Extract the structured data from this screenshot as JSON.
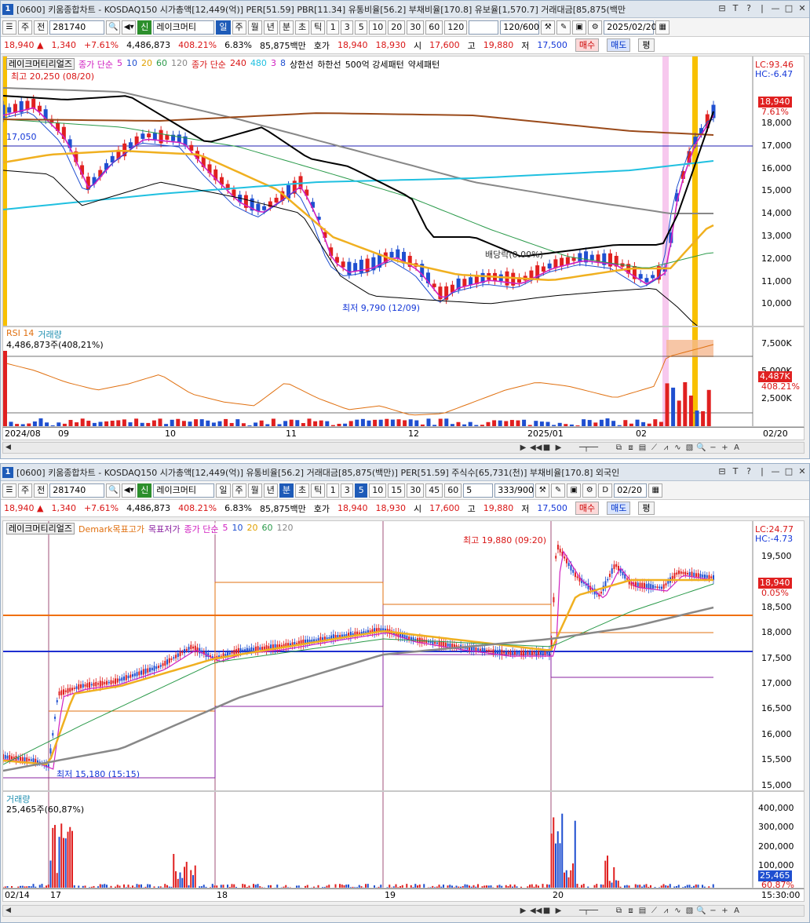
{
  "top": {
    "title": {
      "num": "1",
      "text": "[0600] 키움종합차트 - KOSDAQ150 시가총액[12,449(억)] PER[51.59] PBR[11.34] 유통비율[56.2] 부채비율[170.8] 유보율[1,570.7] 거래대금[85,875(백만"
    },
    "title_buttons": [
      "⊟",
      "T",
      "?",
      "|",
      "—",
      "□",
      "✕"
    ],
    "toolbar": {
      "mode": "주",
      "prev": "전",
      "code": "281740",
      "name": "레이크머티",
      "periods": [
        "일",
        "주",
        "월",
        "년",
        "분",
        "초",
        "틱"
      ],
      "active_period": "일",
      "nums": [
        "1",
        "3",
        "5",
        "10",
        "20",
        "30",
        "60",
        "120"
      ],
      "count": "120/600",
      "date": "2025/02/20"
    },
    "quote": {
      "price": "18,940 ▲",
      "change": "1,340",
      "rate": "+7.61%",
      "volume": "4,486,873",
      "vol_rate": "408.21%",
      "turnover": "6.83%",
      "amount": "85,875백만",
      "bid_label": "호가",
      "ask": "18,940",
      "bid": "18,930",
      "open_label": "시",
      "open": "17,600",
      "high_label": "고",
      "high": "19,880",
      "low_label": "저",
      "low": "17,500",
      "buy": "매수",
      "sell": "매도",
      "avg": "평"
    },
    "legend1": {
      "name": "레이크머티리얼즈",
      "ma_label": "종가 단순",
      "ma": [
        "5",
        "10",
        "20",
        "60",
        "120"
      ]
    },
    "legend1b": {
      "high": "최고 20,250 (08/20)",
      "ma_label": "종가 단순",
      "ma": [
        "240",
        "480",
        "3",
        "8"
      ],
      "upper": "상한선",
      "lower": "하한선",
      "strong": "500억 강세패턴",
      "weak": "약세패턴"
    },
    "annotations": {
      "low": "최저 9,790 (12/09)",
      "dividend": "배당락(0.00%)",
      "left_price": "17,050"
    },
    "right_axis": {
      "lc": "LC:93.46",
      "hc": "HC:-6.47",
      "price_box": "18,940",
      "pct": "7.61%",
      "ticks": [
        "18,000",
        "17,000",
        "16,000",
        "15,000",
        "14,000",
        "13,000",
        "12,000",
        "11,000",
        "10,000"
      ]
    },
    "sub_legend": {
      "rsi": "RSI 14",
      "vol": "거래량",
      "vol_value": "4,486,873주(408,21%)"
    },
    "sub_axis": {
      "ticks": [
        "7,500K",
        "5,000K",
        "2,500K"
      ],
      "box": "4,487K",
      "pct": "408.21%"
    },
    "x_labels": [
      "2024/08",
      "09",
      "10",
      "11",
      "12",
      "2025/01",
      "02"
    ],
    "x_right": "02/20"
  },
  "bottom": {
    "title": {
      "num": "1",
      "text": "[0600] 키움종합차트 - KOSDAQ150 시가총액[12,449(억)] 유통비율[56.2] 거래대금[85,875(백만)] PER[51.59] 주식수[65,731(천)] 부채비율[170.8] 외국인"
    },
    "title_buttons": [
      "⊟",
      "T",
      "?",
      "|",
      "—",
      "□",
      "✕"
    ],
    "toolbar": {
      "mode": "주",
      "prev": "전",
      "code": "281740",
      "name": "레이크머티",
      "periods": [
        "일",
        "주",
        "월",
        "년",
        "분",
        "초",
        "틱"
      ],
      "active_period": "분",
      "nums": [
        "1",
        "3",
        "5",
        "10",
        "15",
        "30",
        "45",
        "60"
      ],
      "active_num": "5",
      "unit": "5",
      "count": "333/900",
      "date_check": "D",
      "date": "02/20"
    },
    "quote": {
      "price": "18,940 ▲",
      "change": "1,340",
      "rate": "+7.61%",
      "volume": "4,486,873",
      "vol_rate": "408.21%",
      "turnover": "6.83%",
      "amount": "85,875백만",
      "bid_label": "호가",
      "ask": "18,940",
      "bid": "18,930",
      "open_label": "시",
      "open": "17,600",
      "high_label": "고",
      "high": "19,880",
      "low_label": "저",
      "low": "17,500",
      "buy": "매수",
      "sell": "매도",
      "avg": "평"
    },
    "legend": {
      "name": "레이크머티리얼즈",
      "demark_high": "Demark목표고가",
      "demark_low": "목표저가",
      "ma_label": "종가 단순",
      "ma": [
        "5",
        "10",
        "20",
        "60",
        "120"
      ]
    },
    "annotations": {
      "high": "최고 19,880 (09:20)",
      "low": "최저 15,180 (15:15)"
    },
    "right_axis": {
      "lc": "LC:24.77",
      "hc": "HC:-4.73",
      "price_box": "18,940",
      "pct": "0.05%",
      "ticks": [
        "19,500",
        "19,000",
        "18,500",
        "18,000",
        "17,500",
        "17,000",
        "16,500",
        "16,000",
        "15,500",
        "15,000"
      ]
    },
    "sub_legend": {
      "vol": "거래량",
      "vol_value": "25,465주(60,87%)"
    },
    "sub_axis": {
      "ticks": [
        "400,000",
        "300,000",
        "200,000",
        "100,000"
      ],
      "box": "25,465",
      "pct": "60.87%"
    },
    "x_labels": [
      "02/14",
      "17",
      "18",
      "19",
      "20"
    ],
    "x_right": "15:30:00"
  },
  "colors": {
    "up": "#e02020",
    "down": "#1f4fd0",
    "ma5": "#d020c0",
    "ma20": "#f0b020",
    "ma60": "#2a9a4a",
    "ma120": "#888888",
    "ma240": "#9a4a1a",
    "cyan": "#20c0e0"
  }
}
